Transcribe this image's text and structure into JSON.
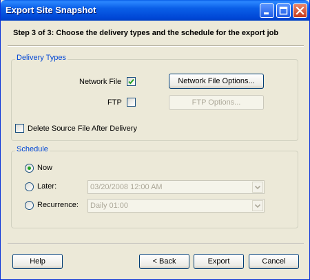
{
  "window": {
    "title": "Export Site Snapshot",
    "controls": {
      "minimize_icon": "minimize-icon",
      "maximize_icon": "maximize-icon",
      "close_icon": "close-icon"
    }
  },
  "step_title": "Step 3 of 3: Choose the delivery types and the schedule for the export job",
  "delivery": {
    "legend": "Delivery Types",
    "network_file_label": "Network File",
    "network_file_checked": true,
    "network_file_options": "Network File Options...",
    "ftp_label": "FTP",
    "ftp_checked": false,
    "ftp_options": "FTP Options...",
    "delete_source_label": "Delete Source File After Delivery",
    "delete_source_checked": false
  },
  "schedule": {
    "legend": "Schedule",
    "selected": "Now",
    "now_label": "Now",
    "later_label": "Later:",
    "later_value": "03/20/2008 12:00 AM",
    "recurrence_label": "Recurrence:",
    "recurrence_value": "Daily 01:00"
  },
  "buttons": {
    "help": "Help",
    "back": "< Back",
    "export": "Export",
    "cancel": "Cancel"
  },
  "colors": {
    "title_bar": "#0a5fe8",
    "dialog_bg": "#ece9d8",
    "group_legend": "#0046d5",
    "radio_dot": "#21a121",
    "check_mark": "#21a121"
  }
}
